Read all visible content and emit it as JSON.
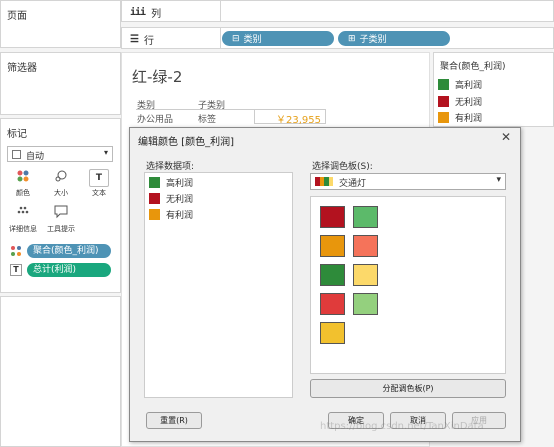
{
  "left": {
    "pages_title": "页面",
    "filters_title": "筛选器",
    "marks_title": "标记",
    "mark_type": "自动",
    "mark_buttons": {
      "color": "颜色",
      "size": "大小",
      "text": "文本",
      "detail": "详细信息",
      "tooltip": "工具提示"
    },
    "mark_text_glyph": "T",
    "fields": [
      {
        "label": "聚合(颜色_利润)",
        "color": "#4e93b5"
      },
      {
        "label": "总计(利润)",
        "color": "#1aa77e"
      }
    ]
  },
  "shelves": {
    "columns_label": "列",
    "rows_label": "行",
    "row_pills": [
      {
        "label": "类别",
        "glyph": "⊟"
      },
      {
        "label": "子类别",
        "glyph": "⊞"
      }
    ]
  },
  "view": {
    "title": "红-绿-2",
    "header1": "类别",
    "header2": "子类别",
    "row_cat": "办公用品",
    "row_sub": "标签",
    "value": "￥23,955",
    "value_color": "#e6a11c"
  },
  "legend": {
    "title": "聚合(颜色_利润)",
    "items": [
      {
        "label": "高利润",
        "color": "#2e8b3a"
      },
      {
        "label": "无利润",
        "color": "#b3121f"
      },
      {
        "label": "有利润",
        "color": "#e8960c"
      }
    ]
  },
  "dialog": {
    "title": "编辑颜色 [颜色_利润]",
    "close_glyph": "✕",
    "data_items_label": "选择数据项:",
    "palette_label": "选择调色板(S):",
    "palette_value": "交通灯",
    "items": [
      {
        "label": "高利润",
        "color": "#2e8b3a"
      },
      {
        "label": "无利润",
        "color": "#b3121f"
      },
      {
        "label": "有利润",
        "color": "#e8960c"
      }
    ],
    "palette_swatches": [
      {
        "color": "#b3121f"
      },
      {
        "color": "#5cba6a"
      },
      {
        "color": "#e8960c"
      },
      {
        "color": "#f5735a"
      },
      {
        "color": "#2e8b3a"
      },
      {
        "color": "#fcd96a"
      },
      {
        "color": "#e03b3b"
      },
      {
        "color": "#94d07e"
      },
      {
        "color": "#f2c12e"
      }
    ],
    "assign_button": "分配调色板(P)",
    "reset_button": "重置(R)",
    "ok_button": "确定",
    "cancel_button": "取消",
    "apply_button": "应用"
  },
  "watermark": "https://blog.csdn.net/TanXinData"
}
